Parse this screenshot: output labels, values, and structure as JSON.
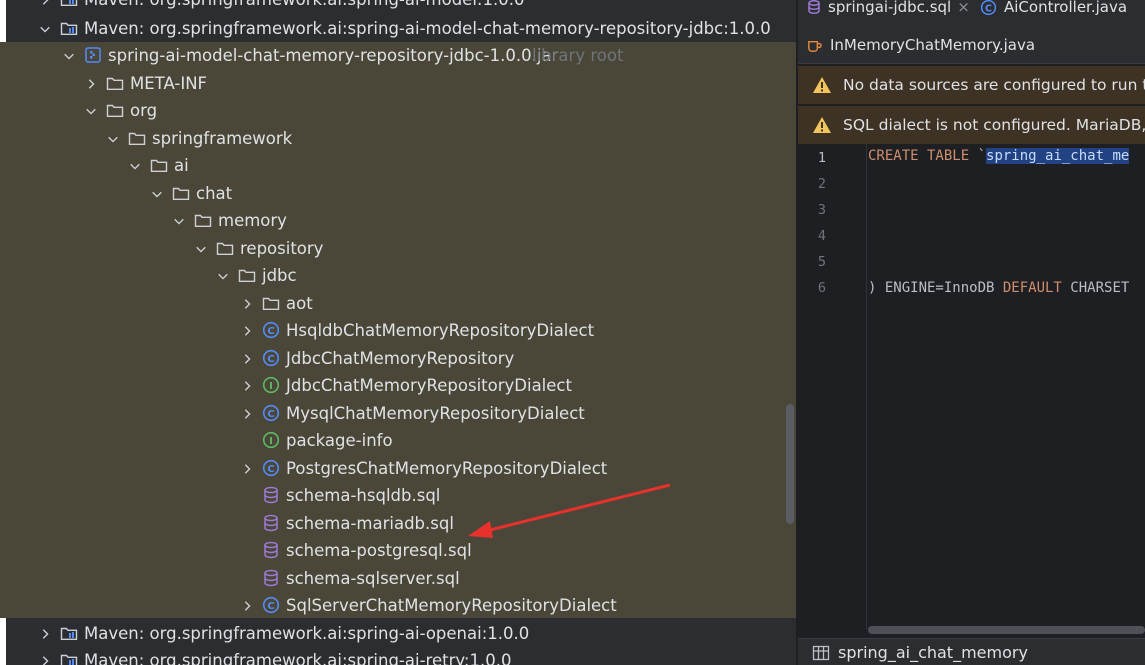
{
  "project_tree": {
    "rows": [
      {
        "label": "Maven: org.springframework.ai:spring-ai-model:1.0.0",
        "icon": "library-icon",
        "chevron": "right"
      },
      {
        "label": "Maven: org.springframework.ai:spring-ai-model-chat-memory-repository-jdbc:1.0.0",
        "icon": "library-icon",
        "chevron": "down"
      },
      {
        "label": "spring-ai-model-chat-memory-repository-jdbc-1.0.0.jar",
        "suffix": "library root",
        "icon": "jar-icon",
        "chevron": "down"
      },
      {
        "label": "META-INF",
        "icon": "folder-icon",
        "chevron": "right"
      },
      {
        "label": "org",
        "icon": "folder-icon",
        "chevron": "down"
      },
      {
        "label": "springframework",
        "icon": "folder-icon",
        "chevron": "down"
      },
      {
        "label": "ai",
        "icon": "folder-icon",
        "chevron": "down"
      },
      {
        "label": "chat",
        "icon": "folder-icon",
        "chevron": "down"
      },
      {
        "label": "memory",
        "icon": "folder-icon",
        "chevron": "down"
      },
      {
        "label": "repository",
        "icon": "folder-icon",
        "chevron": "down"
      },
      {
        "label": "jdbc",
        "icon": "folder-icon",
        "chevron": "down"
      },
      {
        "label": "aot",
        "icon": "folder-icon",
        "chevron": "right"
      },
      {
        "label": "HsqldbChatMemoryRepositoryDialect",
        "icon": "class-icon",
        "chevron": "right"
      },
      {
        "label": "JdbcChatMemoryRepository",
        "icon": "class-icon",
        "chevron": "right"
      },
      {
        "label": "JdbcChatMemoryRepositoryDialect",
        "icon": "interface-icon",
        "chevron": "right"
      },
      {
        "label": "MysqlChatMemoryRepositoryDialect",
        "icon": "class-icon",
        "chevron": "right"
      },
      {
        "label": "package-info",
        "icon": "interface-icon",
        "chevron": "none"
      },
      {
        "label": "PostgresChatMemoryRepositoryDialect",
        "icon": "class-icon",
        "chevron": "right"
      },
      {
        "label": "schema-hsqldb.sql",
        "icon": "sql-file-icon",
        "chevron": "none"
      },
      {
        "label": "schema-mariadb.sql",
        "icon": "sql-file-icon",
        "chevron": "none"
      },
      {
        "label": "schema-postgresql.sql",
        "icon": "sql-file-icon",
        "chevron": "none"
      },
      {
        "label": "schema-sqlserver.sql",
        "icon": "sql-file-icon",
        "chevron": "none"
      },
      {
        "label": "SqlServerChatMemoryRepositoryDialect",
        "icon": "class-icon",
        "chevron": "right"
      },
      {
        "label": "Maven: org.springframework.ai:spring-ai-openai:1.0.0",
        "icon": "library-icon",
        "chevron": "right"
      },
      {
        "label": "Maven: org.springframework.ai:spring-ai-retry:1.0.0",
        "icon": "library-icon",
        "chevron": "right"
      }
    ]
  },
  "editor": {
    "tabs": [
      {
        "label": "springai-jdbc.sql",
        "icon": "database-icon",
        "close": "×"
      },
      {
        "label": "AiController.java",
        "icon": "class-icon"
      },
      {
        "label": "InMemoryChatMemory.java",
        "icon": "cup-icon"
      }
    ],
    "banners": [
      {
        "text": "No data sources are configured to run t",
        "icon": "warning-icon"
      },
      {
        "text": "SQL dialect is not configured. MariaDB,",
        "icon": "warning-icon"
      }
    ],
    "line_numbers": [
      "1",
      "2",
      "3",
      "4",
      "5",
      "6"
    ],
    "code": {
      "line1_kw": "CREATE TABLE ",
      "line1_tick": "`",
      "line1_sel": "spring_ai_chat_me",
      "line6_a": ") ENGINE=InnoDB ",
      "line6_kw": "DEFAULT",
      "line6_b": " CHARSET"
    },
    "bottom_label": "spring_ai_chat_memory"
  },
  "colors": {
    "selection_bg": "#4b4738",
    "annotation_arrow": "#e8312d",
    "class_icon": "#548af7",
    "interface_icon": "#5fb865",
    "sql_icon": "#9c7ad6",
    "warning": "#f2c55c"
  }
}
